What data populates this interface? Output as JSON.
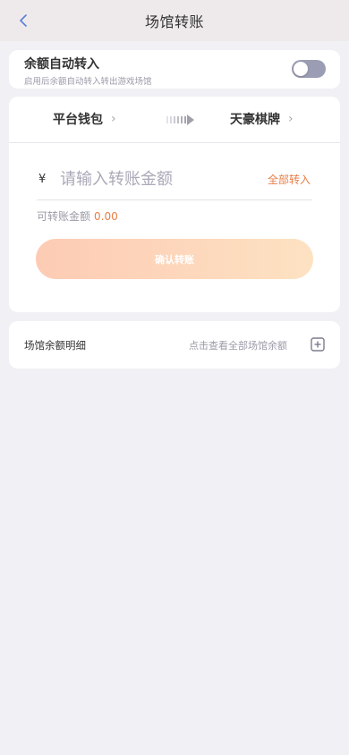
{
  "header": {
    "title": "场馆转账",
    "back_icon": "chevron-left-icon"
  },
  "auto_transfer": {
    "title": "余额自动转入",
    "subtitle": "启用后余额自动转入转出游戏场馆",
    "enabled": false
  },
  "transfer": {
    "from_wallet": "平台钱包",
    "to_wallet": "天豪棋牌",
    "currency_symbol": "¥",
    "amount_placeholder": "请输入转账金额",
    "all_in_label": "全部转入",
    "available_label": "可转账金额",
    "available_value": "0.00",
    "confirm_label": "确认转账"
  },
  "venue_detail": {
    "title": "场馆余额明细",
    "hint": "点击查看全部场馆余额"
  },
  "colors": {
    "accent": "#e87e46",
    "button_gradient_start": "#fdcbb4",
    "button_gradient_end": "#fde2c2",
    "toggle_off": "#9a9db3",
    "header_bg": "#eeeaec",
    "page_bg": "#f1f0f4"
  }
}
